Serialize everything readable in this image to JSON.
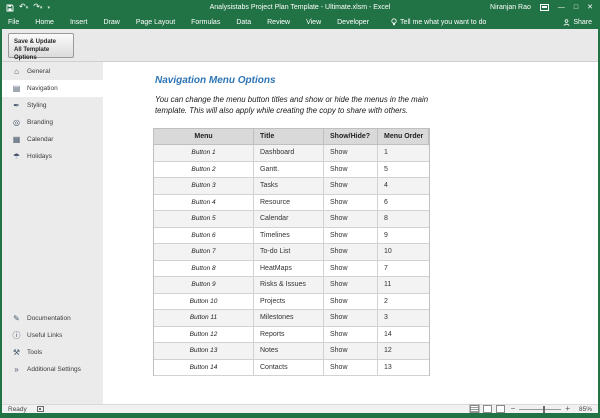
{
  "window": {
    "title": "Analysistabs Project Plan Template - Ultimate.xlsm - Excel",
    "user": "Niranjan Rao"
  },
  "ribbon": {
    "tabs": [
      "File",
      "Home",
      "Insert",
      "Draw",
      "Page Layout",
      "Formulas",
      "Data",
      "Review",
      "View",
      "Developer"
    ],
    "tell_me": "Tell me what you want to do",
    "share_label": "Share",
    "save_update_line1": "Save & Update",
    "save_update_line2": "All Template Options"
  },
  "sidebar": {
    "items": [
      {
        "id": "general",
        "label": "General",
        "glyph": "⌂",
        "selected": false
      },
      {
        "id": "navigation",
        "label": "Navigation",
        "glyph": "▤",
        "selected": true
      },
      {
        "id": "styling",
        "label": "Styling",
        "glyph": "✒",
        "selected": false
      },
      {
        "id": "branding",
        "label": "Branding",
        "glyph": "◎",
        "selected": false
      },
      {
        "id": "calendar",
        "label": "Calendar",
        "glyph": "▦",
        "selected": false
      },
      {
        "id": "holidays",
        "label": "Holidays",
        "glyph": "☂",
        "selected": false
      }
    ],
    "footer_items": [
      {
        "id": "documentation",
        "label": "Documentation",
        "glyph": "✎",
        "selected": false
      },
      {
        "id": "useful-links",
        "label": "Useful Links",
        "glyph": "ⓘ",
        "selected": false
      },
      {
        "id": "tools",
        "label": "Tools",
        "glyph": "⚒",
        "selected": false
      },
      {
        "id": "additional-settings",
        "label": "Additional Settings",
        "glyph": "»",
        "selected": false
      }
    ]
  },
  "main": {
    "heading": "Navigation Menu Options",
    "description_line1": "You can change the menu button titles and show or hide the menus in the main",
    "description_line2": "template. This will also apply while creating the copy to share with others.",
    "table": {
      "headers": [
        "Menu",
        "Title",
        "Show/Hide?",
        "Menu Order"
      ],
      "rows": [
        {
          "menu": "Button 1",
          "title": "Dashboard",
          "show": "Show",
          "order": "1"
        },
        {
          "menu": "Button 2",
          "title": "Gantt.",
          "show": "Show",
          "order": "5"
        },
        {
          "menu": "Button 3",
          "title": "Tasks",
          "show": "Show",
          "order": "4"
        },
        {
          "menu": "Button 4",
          "title": "Resource",
          "show": "Show",
          "order": "6"
        },
        {
          "menu": "Button 5",
          "title": "Calendar",
          "show": "Show",
          "order": "8"
        },
        {
          "menu": "Button 6",
          "title": "Timelines",
          "show": "Show",
          "order": "9"
        },
        {
          "menu": "Button 7",
          "title": "To-do List",
          "show": "Show",
          "order": "10"
        },
        {
          "menu": "Button 8",
          "title": "HeatMaps",
          "show": "Show",
          "order": "7"
        },
        {
          "menu": "Button 9",
          "title": "Risks & Issues",
          "show": "Show",
          "order": "11"
        },
        {
          "menu": "Button 10",
          "title": "Projects",
          "show": "Show",
          "order": "2"
        },
        {
          "menu": "Button 11",
          "title": "Milestones",
          "show": "Show",
          "order": "3"
        },
        {
          "menu": "Button 12",
          "title": "Reports",
          "show": "Show",
          "order": "14"
        },
        {
          "menu": "Button 13",
          "title": "Notes",
          "show": "Show",
          "order": "12"
        },
        {
          "menu": "Button 14",
          "title": "Contacts",
          "show": "Show",
          "order": "13"
        }
      ]
    }
  },
  "status_bar": {
    "status": "Ready",
    "zoom_level": "85%"
  },
  "colors": {
    "excel_green": "#217346",
    "heading_blue": "#2e75b6",
    "table_header_bg": "#d9d9d9"
  }
}
